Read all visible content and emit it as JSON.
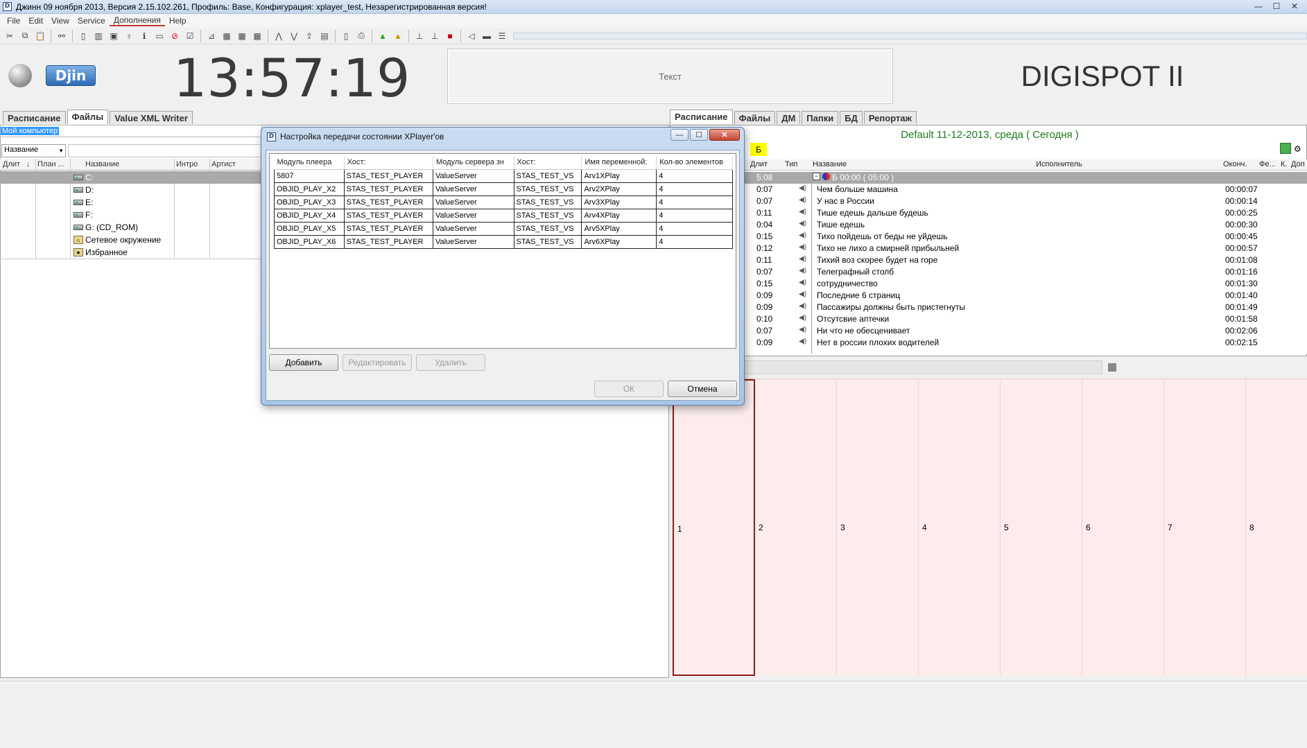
{
  "window": {
    "title": "Джинн 09 ноября 2013, Версия 2.15.102.261, Профиль: Base, Конфигурация: xplayer_test, Незарегистрированная версия!",
    "logo_text": "D",
    "controls": {
      "minimize": "—",
      "maximize": "☐",
      "close": "✕"
    }
  },
  "menu": [
    "File",
    "Edit",
    "View",
    "Service",
    "Дополнения",
    "Help"
  ],
  "header": {
    "logo_text": "Djin",
    "clock": "13:57:19",
    "text_panel": "Текст",
    "brand": "DIGISPOT II"
  },
  "left_panel": {
    "tabs": [
      "Расписание",
      "Файлы",
      "Value XML Writer"
    ],
    "active_tab": "Файлы",
    "path": "Мой компьютер",
    "sort_select": "Название",
    "columns": [
      "Длит",
      "План ...",
      "Название",
      "Интро",
      "Артист"
    ],
    "items": [
      {
        "name": "C:",
        "type": "drive",
        "selected": true
      },
      {
        "name": "D:",
        "type": "drive"
      },
      {
        "name": "E:",
        "type": "drive"
      },
      {
        "name": "F:",
        "type": "drive"
      },
      {
        "name": "G: (CD_ROM)",
        "type": "drive"
      },
      {
        "name": "Сетевое окружение",
        "type": "network"
      },
      {
        "name": "Избранное",
        "type": "favorites"
      }
    ]
  },
  "right_panel": {
    "tabs": [
      "Расписание",
      "Файлы",
      "ДМ",
      "Папки",
      "БД",
      "Репортаж"
    ],
    "active_tab": "Расписание",
    "date_header": "Default 11-12-2013, среда ( Сегодня )",
    "marker": "Б",
    "columns": [
      "Длит",
      "Тип",
      "Название",
      "Исполнитель",
      "Оконч.",
      "Фе...",
      "К.",
      "Доп"
    ],
    "block_row": {
      "duration": "5:08",
      "name": "Б 00:00 ( 05:00 )"
    },
    "rows": [
      {
        "duration": "0:07",
        "name": "Чем больше машина",
        "end": "00:00:07"
      },
      {
        "duration": "0:07",
        "name": "У нас в России",
        "end": "00:00:14"
      },
      {
        "duration": "0:11",
        "name": "Тише едешь дальше будешь",
        "end": "00:00:25"
      },
      {
        "duration": "0:04",
        "name": "Тише едешь",
        "end": "00:00:30"
      },
      {
        "duration": "0:15",
        "name": "Тихо пойдешь от беды не уйдешь",
        "end": "00:00:45"
      },
      {
        "duration": "0:12",
        "name": "Тихо не лихо а смирней прибыльней",
        "end": "00:00:57"
      },
      {
        "duration": "0:11",
        "name": "Тихий воз скорее будет на горе",
        "end": "00:01:08"
      },
      {
        "duration": "0:07",
        "name": "Телеграфный столб",
        "end": "00:01:16"
      },
      {
        "duration": "0:15",
        "name": "сотрудничество",
        "end": "00:01:30"
      },
      {
        "duration": "0:09",
        "name": "Последние 6 страниц",
        "end": "00:01:40"
      },
      {
        "duration": "0:09",
        "name": "Пассажиры должны быть пристегнуты",
        "end": "00:01:49"
      },
      {
        "duration": "0:10",
        "name": "Отсутсвие аптечки",
        "end": "00:01:58"
      },
      {
        "duration": "0:07",
        "name": "Ни что не обесценивает",
        "end": "00:02:06"
      },
      {
        "duration": "0:09",
        "name": "Нет в россии плохих водителей",
        "end": "00:02:15"
      }
    ],
    "grid_cells": [
      "1",
      "2",
      "3",
      "4",
      "5",
      "6",
      "7",
      "8"
    ]
  },
  "dialog": {
    "title": "Настройка передачи состоянии XPlayer'ов",
    "logo_text": "D",
    "controls": {
      "minimize": "—",
      "maximize": "☐",
      "close": "✕"
    },
    "columns": [
      "Модуль плеера",
      "Хост:",
      "Модуль сервера зн",
      "Хост:",
      "Имя переменной:",
      "Кол-во элементов"
    ],
    "rows": [
      [
        "5807",
        "STAS_TEST_PLAYER",
        "ValueServer",
        "STAS_TEST_VS",
        "Arv1XPlay",
        "4"
      ],
      [
        "OBJID_PLAY_X2",
        "STAS_TEST_PLAYER",
        "ValueServer",
        "STAS_TEST_VS",
        "Arv2XPlay",
        "4"
      ],
      [
        "OBJID_PLAY_X3",
        "STAS_TEST_PLAYER",
        "ValueServer",
        "STAS_TEST_VS",
        "Arv3XPlay",
        "4"
      ],
      [
        "OBJID_PLAY_X4",
        "STAS_TEST_PLAYER",
        "ValueServer",
        "STAS_TEST_VS",
        "Arv4XPlay",
        "4"
      ],
      [
        "OBJID_PLAY_X5",
        "STAS_TEST_PLAYER",
        "ValueServer",
        "STAS_TEST_VS",
        "Arv5XPlay",
        "4"
      ],
      [
        "OBJID_PLAY_X6",
        "STAS_TEST_PLAYER",
        "ValueServer",
        "STAS_TEST_VS",
        "Arv6XPlay",
        "4"
      ]
    ],
    "buttons": {
      "add": "Добавить",
      "edit": "Редактировать",
      "delete": "Удалить",
      "ok": "ОК",
      "cancel": "Отмена"
    }
  }
}
